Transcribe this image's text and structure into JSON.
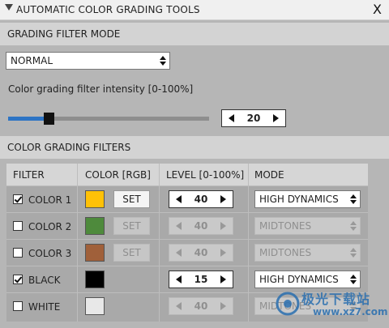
{
  "window": {
    "title": "AUTOMATIC COLOR GRADING TOOLS",
    "close_label": "X"
  },
  "mode_section": {
    "header": "GRADING FILTER MODE",
    "mode_select_value": "NORMAL",
    "intensity_label": "Color grading filter intensity [0-100%]",
    "intensity_value": "20",
    "intensity_fraction": 0.2
  },
  "filters_section": {
    "header": "COLOR GRADING FILTERS",
    "columns": [
      "FILTER",
      "COLOR [RGB]",
      "LEVEL [0-100%]",
      "MODE"
    ],
    "rows": [
      {
        "name": "COLOR 1",
        "checked": true,
        "swatch": "#ffc107",
        "set_label": "SET",
        "has_set": true,
        "level": "40",
        "mode": "HIGH DYNAMICS"
      },
      {
        "name": "COLOR 2",
        "checked": false,
        "swatch": "#4e8a3c",
        "set_label": "SET",
        "has_set": true,
        "level": "40",
        "mode": "MIDTONES"
      },
      {
        "name": "COLOR 3",
        "checked": false,
        "swatch": "#a0603a",
        "set_label": "SET",
        "has_set": true,
        "level": "40",
        "mode": "MIDTONES"
      },
      {
        "name": "BLACK",
        "checked": true,
        "swatch": "#000000",
        "set_label": "",
        "has_set": false,
        "level": "15",
        "mode": "HIGH DYNAMICS"
      },
      {
        "name": "WHITE",
        "checked": false,
        "swatch": "#e8e8e8",
        "set_label": "",
        "has_set": false,
        "level": "40",
        "mode": "MIDTONES"
      }
    ]
  },
  "watermark": {
    "text": "极光下载站",
    "sub": "www.xz7.com"
  }
}
